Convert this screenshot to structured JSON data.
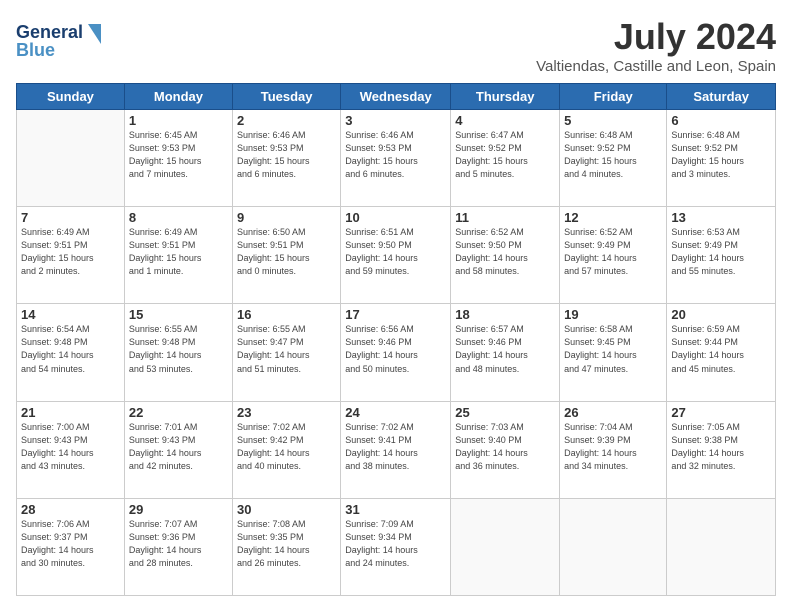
{
  "header": {
    "logo_general": "General",
    "logo_blue": "Blue",
    "title": "July 2024",
    "subtitle": "Valtiendas, Castille and Leon, Spain"
  },
  "days_of_week": [
    "Sunday",
    "Monday",
    "Tuesday",
    "Wednesday",
    "Thursday",
    "Friday",
    "Saturday"
  ],
  "weeks": [
    [
      {
        "day": "",
        "info": ""
      },
      {
        "day": "1",
        "info": "Sunrise: 6:45 AM\nSunset: 9:53 PM\nDaylight: 15 hours\nand 7 minutes."
      },
      {
        "day": "2",
        "info": "Sunrise: 6:46 AM\nSunset: 9:53 PM\nDaylight: 15 hours\nand 6 minutes."
      },
      {
        "day": "3",
        "info": "Sunrise: 6:46 AM\nSunset: 9:53 PM\nDaylight: 15 hours\nand 6 minutes."
      },
      {
        "day": "4",
        "info": "Sunrise: 6:47 AM\nSunset: 9:52 PM\nDaylight: 15 hours\nand 5 minutes."
      },
      {
        "day": "5",
        "info": "Sunrise: 6:48 AM\nSunset: 9:52 PM\nDaylight: 15 hours\nand 4 minutes."
      },
      {
        "day": "6",
        "info": "Sunrise: 6:48 AM\nSunset: 9:52 PM\nDaylight: 15 hours\nand 3 minutes."
      }
    ],
    [
      {
        "day": "7",
        "info": "Sunrise: 6:49 AM\nSunset: 9:51 PM\nDaylight: 15 hours\nand 2 minutes."
      },
      {
        "day": "8",
        "info": "Sunrise: 6:49 AM\nSunset: 9:51 PM\nDaylight: 15 hours\nand 1 minute."
      },
      {
        "day": "9",
        "info": "Sunrise: 6:50 AM\nSunset: 9:51 PM\nDaylight: 15 hours\nand 0 minutes."
      },
      {
        "day": "10",
        "info": "Sunrise: 6:51 AM\nSunset: 9:50 PM\nDaylight: 14 hours\nand 59 minutes."
      },
      {
        "day": "11",
        "info": "Sunrise: 6:52 AM\nSunset: 9:50 PM\nDaylight: 14 hours\nand 58 minutes."
      },
      {
        "day": "12",
        "info": "Sunrise: 6:52 AM\nSunset: 9:49 PM\nDaylight: 14 hours\nand 57 minutes."
      },
      {
        "day": "13",
        "info": "Sunrise: 6:53 AM\nSunset: 9:49 PM\nDaylight: 14 hours\nand 55 minutes."
      }
    ],
    [
      {
        "day": "14",
        "info": "Sunrise: 6:54 AM\nSunset: 9:48 PM\nDaylight: 14 hours\nand 54 minutes."
      },
      {
        "day": "15",
        "info": "Sunrise: 6:55 AM\nSunset: 9:48 PM\nDaylight: 14 hours\nand 53 minutes."
      },
      {
        "day": "16",
        "info": "Sunrise: 6:55 AM\nSunset: 9:47 PM\nDaylight: 14 hours\nand 51 minutes."
      },
      {
        "day": "17",
        "info": "Sunrise: 6:56 AM\nSunset: 9:46 PM\nDaylight: 14 hours\nand 50 minutes."
      },
      {
        "day": "18",
        "info": "Sunrise: 6:57 AM\nSunset: 9:46 PM\nDaylight: 14 hours\nand 48 minutes."
      },
      {
        "day": "19",
        "info": "Sunrise: 6:58 AM\nSunset: 9:45 PM\nDaylight: 14 hours\nand 47 minutes."
      },
      {
        "day": "20",
        "info": "Sunrise: 6:59 AM\nSunset: 9:44 PM\nDaylight: 14 hours\nand 45 minutes."
      }
    ],
    [
      {
        "day": "21",
        "info": "Sunrise: 7:00 AM\nSunset: 9:43 PM\nDaylight: 14 hours\nand 43 minutes."
      },
      {
        "day": "22",
        "info": "Sunrise: 7:01 AM\nSunset: 9:43 PM\nDaylight: 14 hours\nand 42 minutes."
      },
      {
        "day": "23",
        "info": "Sunrise: 7:02 AM\nSunset: 9:42 PM\nDaylight: 14 hours\nand 40 minutes."
      },
      {
        "day": "24",
        "info": "Sunrise: 7:02 AM\nSunset: 9:41 PM\nDaylight: 14 hours\nand 38 minutes."
      },
      {
        "day": "25",
        "info": "Sunrise: 7:03 AM\nSunset: 9:40 PM\nDaylight: 14 hours\nand 36 minutes."
      },
      {
        "day": "26",
        "info": "Sunrise: 7:04 AM\nSunset: 9:39 PM\nDaylight: 14 hours\nand 34 minutes."
      },
      {
        "day": "27",
        "info": "Sunrise: 7:05 AM\nSunset: 9:38 PM\nDaylight: 14 hours\nand 32 minutes."
      }
    ],
    [
      {
        "day": "28",
        "info": "Sunrise: 7:06 AM\nSunset: 9:37 PM\nDaylight: 14 hours\nand 30 minutes."
      },
      {
        "day": "29",
        "info": "Sunrise: 7:07 AM\nSunset: 9:36 PM\nDaylight: 14 hours\nand 28 minutes."
      },
      {
        "day": "30",
        "info": "Sunrise: 7:08 AM\nSunset: 9:35 PM\nDaylight: 14 hours\nand 26 minutes."
      },
      {
        "day": "31",
        "info": "Sunrise: 7:09 AM\nSunset: 9:34 PM\nDaylight: 14 hours\nand 24 minutes."
      },
      {
        "day": "",
        "info": ""
      },
      {
        "day": "",
        "info": ""
      },
      {
        "day": "",
        "info": ""
      }
    ]
  ]
}
